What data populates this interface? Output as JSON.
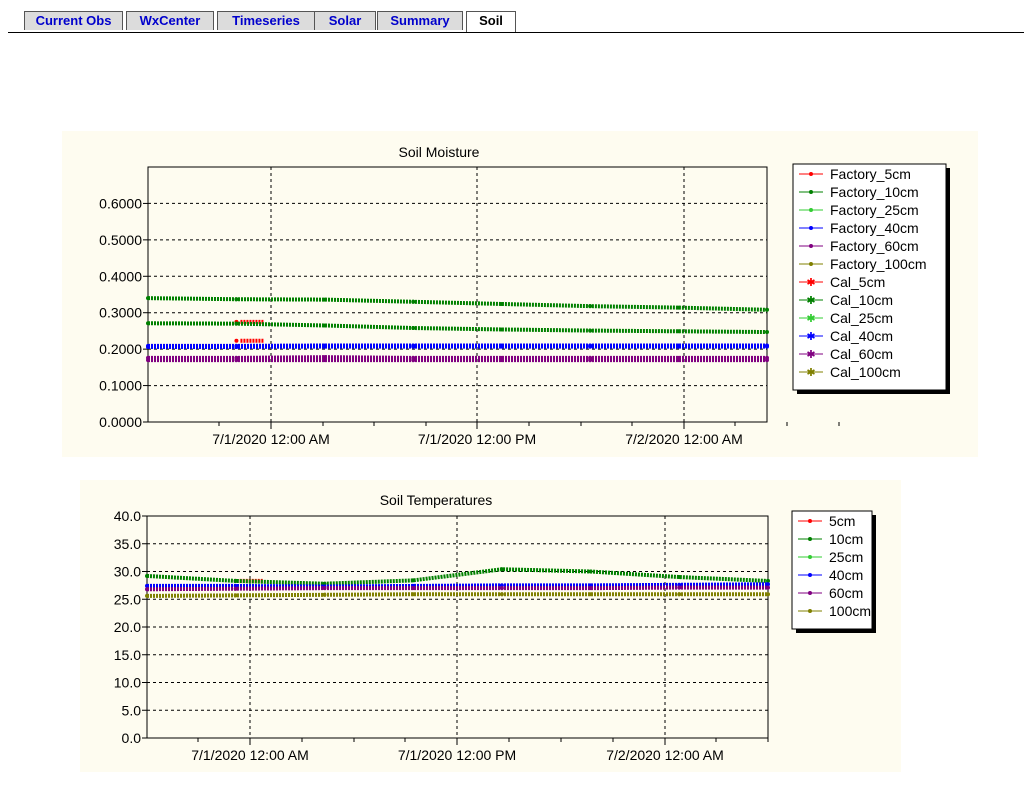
{
  "tabs": [
    {
      "label": "Current Obs",
      "active": false
    },
    {
      "label": "WxCenter",
      "active": false
    },
    {
      "label": "Timeseries",
      "active": false
    },
    {
      "label": "Solar",
      "active": false
    },
    {
      "label": "Summary",
      "active": false
    },
    {
      "label": "Soil",
      "active": true
    }
  ],
  "chart_data": [
    {
      "type": "line",
      "title": "Soil Moisture",
      "xlabel": "",
      "ylabel": "",
      "x_ticks": [
        "7/1/2020 12:00 AM",
        "7/1/2020 12:00 PM",
        "7/2/2020 12:00 AM"
      ],
      "ylim": [
        0,
        0.7
      ],
      "y_ticks": [
        "0.0000",
        "0.1000",
        "0.2000",
        "0.3000",
        "0.4000",
        "0.5000",
        "0.6000"
      ],
      "grid": true,
      "legend_position": "right",
      "x": [
        "6/30/2020 10:00 PM",
        "7/1/2020 4:00 AM",
        "7/1/2020 10:00 AM",
        "7/1/2020 4:00 PM",
        "7/1/2020 10:00 PM",
        "7/2/2020 4:00 AM",
        "7/2/2020 10:00 AM",
        "7/2/2020 4:00 PM"
      ],
      "series": [
        {
          "name": "Factory_5cm",
          "color": "#ff0000",
          "values": [
            null,
            0.223,
            null,
            null,
            null,
            null,
            null,
            null
          ]
        },
        {
          "name": "Factory_10cm",
          "color": "#008000",
          "values": [
            0.34,
            0.337,
            0.336,
            0.33,
            0.324,
            0.318,
            0.314,
            0.308
          ]
        },
        {
          "name": "Factory_25cm",
          "color": "#33cc33",
          "values": [
            null,
            null,
            null,
            null,
            null,
            null,
            null,
            null
          ]
        },
        {
          "name": "Factory_40cm",
          "color": "#0000ff",
          "values": [
            0.209,
            0.209,
            0.21,
            0.21,
            0.21,
            0.21,
            0.21,
            0.21
          ]
        },
        {
          "name": "Factory_60cm",
          "color": "#800080",
          "values": [
            0.176,
            0.176,
            0.178,
            0.176,
            0.176,
            0.176,
            0.176,
            0.176
          ]
        },
        {
          "name": "Factory_100cm",
          "color": "#808000",
          "values": [
            null,
            null,
            null,
            null,
            null,
            null,
            null,
            null
          ]
        },
        {
          "name": "Cal_5cm",
          "color": "#ff0000",
          "values": [
            null,
            0.275,
            null,
            null,
            null,
            null,
            null,
            null
          ]
        },
        {
          "name": "Cal_10cm",
          "color": "#008000",
          "values": [
            0.271,
            0.27,
            0.265,
            0.258,
            0.254,
            0.251,
            0.249,
            0.247
          ]
        },
        {
          "name": "Cal_25cm",
          "color": "#33cc33",
          "values": [
            null,
            null,
            null,
            null,
            null,
            null,
            null,
            null
          ]
        },
        {
          "name": "Cal_40cm",
          "color": "#0000ff",
          "values": [
            0.206,
            0.206,
            0.207,
            0.207,
            0.207,
            0.207,
            0.207,
            0.207
          ]
        },
        {
          "name": "Cal_60cm",
          "color": "#800080",
          "values": [
            0.17,
            0.17,
            0.17,
            0.17,
            0.17,
            0.17,
            0.17,
            0.17
          ]
        },
        {
          "name": "Cal_100cm",
          "color": "#808000",
          "values": [
            null,
            null,
            null,
            null,
            null,
            null,
            null,
            null
          ]
        }
      ]
    },
    {
      "type": "line",
      "title": "Soil Temperatures",
      "xlabel": "",
      "ylabel": "",
      "x_ticks": [
        "7/1/2020 12:00 AM",
        "7/1/2020 12:00 PM",
        "7/2/2020 12:00 AM"
      ],
      "ylim": [
        0,
        40
      ],
      "y_ticks": [
        "0.0",
        "5.0",
        "10.0",
        "15.0",
        "20.0",
        "25.0",
        "30.0",
        "35.0",
        "40.0"
      ],
      "grid": true,
      "legend_position": "right",
      "x": [
        "6/30/2020 10:00 PM",
        "7/1/2020 4:00 AM",
        "7/1/2020 10:00 AM",
        "7/1/2020 4:00 PM",
        "7/1/2020 10:00 PM",
        "7/2/2020 4:00 AM",
        "7/2/2020 10:00 AM",
        "7/2/2020 4:00 PM"
      ],
      "series": [
        {
          "name": "5cm",
          "color": "#ff0000",
          "values": [
            null,
            28.3,
            null,
            null,
            null,
            null,
            null,
            null
          ]
        },
        {
          "name": "10cm",
          "color": "#008000",
          "values": [
            29.2,
            28.3,
            27.8,
            28.4,
            30.4,
            30.0,
            29.0,
            28.3
          ]
        },
        {
          "name": "25cm",
          "color": "#33cc33",
          "values": [
            null,
            null,
            null,
            null,
            null,
            null,
            null,
            null
          ]
        },
        {
          "name": "40cm",
          "color": "#0000ff",
          "values": [
            27.4,
            27.4,
            27.3,
            27.4,
            27.5,
            27.5,
            27.6,
            27.7
          ]
        },
        {
          "name": "60cm",
          "color": "#800080",
          "values": [
            26.8,
            26.9,
            27.0,
            27.0,
            27.0,
            27.0,
            27.1,
            27.1
          ]
        },
        {
          "name": "100cm",
          "color": "#808000",
          "values": [
            25.6,
            25.7,
            25.8,
            25.9,
            25.9,
            25.9,
            25.9,
            25.9
          ]
        }
      ]
    }
  ]
}
